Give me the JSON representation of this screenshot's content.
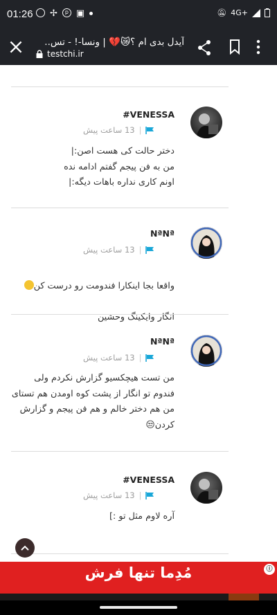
{
  "status_bar": {
    "time": "01:26",
    "network": "4G+"
  },
  "toolbar": {
    "title": "آیدل بدی ام ؟😿💔 | ونسا-! - تس..",
    "url": "testchi.ir"
  },
  "comments": [
    {
      "author": "#VENESSA",
      "time": "13 ساعت پیش",
      "text": "دختر حالت کی هست اصن:|\nمن به فن پیجم گفتم ادامه نده\nاونم کاری نداره باهات دیگه:|"
    },
    {
      "author": "NªNª",
      "time": "13 ساعت پیش",
      "text": "واقعا بجا اینکارا فندومت رو درست کن",
      "text_line2": "انگار وایکینگ وحشین"
    },
    {
      "author": "NªNª",
      "time": "13 ساعت پیش",
      "text": "من تست هیچکسیو گزارش نکردم ولی\nفندوم تو انگار از پشت کوه اومدن هم تستای\nمن هم دختر خالم و هم فن پیجم و گزارش\nکردن😒"
    },
    {
      "author": "#VENESSA",
      "time": "13 ساعت پیش",
      "text": "آره لاوم مثل تو :]"
    }
  ],
  "ad": {
    "text": "مُدِما تنها فرش"
  }
}
